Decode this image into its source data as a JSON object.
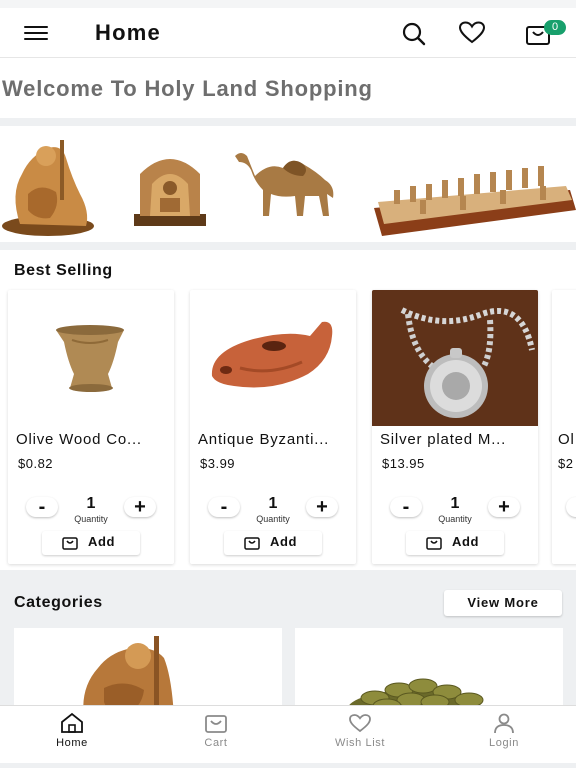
{
  "header": {
    "title": "Home",
    "cart_count": "0",
    "icons": [
      "menu-icon",
      "search-icon",
      "heart-icon",
      "cart-icon"
    ]
  },
  "welcome": {
    "text": "Welcome To Holy Land Shopping"
  },
  "best_selling": {
    "title": "Best Selling",
    "quantity_label": "Quantity",
    "add_label": "Add",
    "products": [
      {
        "name": "Olive Wood Co...",
        "price": "$0.82",
        "qty": "1"
      },
      {
        "name": "Antique Byzanti...",
        "price": "$3.99",
        "qty": "1"
      },
      {
        "name": "Silver plated M...",
        "price": "$13.95",
        "qty": "1"
      },
      {
        "name": "Ol",
        "price": "$2"
      }
    ]
  },
  "categories": {
    "title": "Categories",
    "view_more": "View More"
  },
  "tabs": [
    {
      "label": "Home",
      "icon": "home-icon",
      "active": true
    },
    {
      "label": "Cart",
      "icon": "bag-icon",
      "active": false
    },
    {
      "label": "Wish List",
      "icon": "heart-icon",
      "active": false
    },
    {
      "label": "Login",
      "icon": "user-icon",
      "active": false
    }
  ],
  "colors": {
    "badge": "#18a06c",
    "text_dark": "#111111",
    "welcome_text": "#6e6e6e",
    "tab_inactive": "#8a8a8a"
  }
}
